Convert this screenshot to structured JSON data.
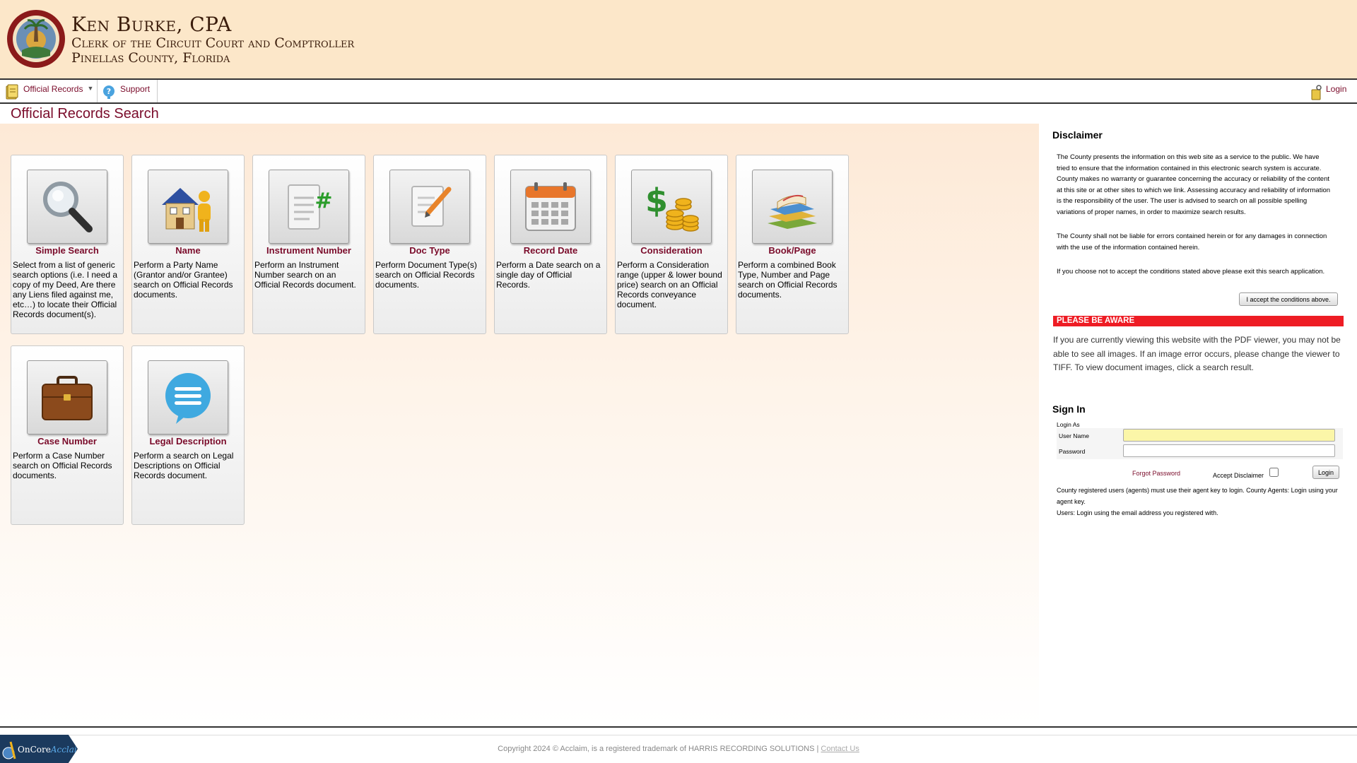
{
  "header": {
    "name": "Ken Burke, CPA",
    "subtitle1": "Clerk of the Circuit Court and Comptroller",
    "subtitle2": "Pinellas County, Florida"
  },
  "nav": {
    "official_records": "Official Records",
    "support": "Support",
    "login": "Login"
  },
  "page_title": "Official Records Search",
  "tiles_row1": [
    {
      "name": "Simple Search",
      "desc": "Select from a list of generic search options (i.e. I need a copy of my Deed, Are there any Liens filed against me, etc…) to locate their Official Records document(s)."
    },
    {
      "name": "Name",
      "desc": "Perform a Party Name (Grantor and/or Grantee) search on Official Records documents."
    },
    {
      "name": "Instrument Number",
      "desc": "Perform an Instrument Number search on an Official Records document."
    },
    {
      "name": "Doc Type",
      "desc": "Perform Document Type(s) search on Official Records documents."
    },
    {
      "name": "Record Date",
      "desc": "Perform a Date search on a single day of Official Records."
    },
    {
      "name": "Consideration",
      "desc": "Perform a Consideration range (upper & lower bound price) search on an Official Records conveyance document."
    },
    {
      "name": "Book/Page",
      "desc": "Perform a combined Book Type, Number and Page search on Official Records documents."
    }
  ],
  "tiles_row2": [
    {
      "name": "Case Number",
      "desc": "Perform a Case Number search on Official Records documents."
    },
    {
      "name": "Legal Description",
      "desc": "Perform a search on Legal Descriptions on Official Records document."
    }
  ],
  "disclaimer": {
    "title": "Disclaimer",
    "p1": "The County presents the information on this web site as a service to the public. We have tried to ensure that the information contained in this electronic search system is accurate. County makes no warranty or guarantee concerning the accuracy or reliability of the content at this site or at other sites to which we link. Assessing accuracy and reliability of information is the responsibility of the user. The user is advised to search on all possible spelling variations of proper names, in order to maximize search results.",
    "p2": "The County shall not be liable for errors contained herein or for any damages in connection with the use of the information contained herein.",
    "p3": "If you choose not to accept the conditions stated above please exit this search application.",
    "accept_button": "I accept the conditions above."
  },
  "aware": {
    "title": "PLEASE BE AWARE",
    "text": "If you are currently viewing this website with the PDF viewer, you may not be able to see all images. If an image error occurs, please change the viewer to TIFF. To view document images, click a search result."
  },
  "signin": {
    "title": "Sign In",
    "login_as": "Login As",
    "username_label": "User Name",
    "password_label": "Password",
    "username_value": "",
    "password_value": "",
    "forgot": "Forgot Password",
    "accept_disclaimer": "Accept Disclaimer",
    "login_button": "Login",
    "note1": "County registered users (agents) must use their agent key to login. County Agents: Login using your agent key.",
    "note2": "Users: Login using the email address you registered with."
  },
  "footer": {
    "logo_part1": "OnCore",
    "logo_part2": "Acclaim",
    "copyright": "Copyright 2024 © Acclaim, is a registered trademark of HARRIS RECORDING SOLUTIONS |",
    "contact": "Contact Us"
  },
  "colors": {
    "header_bg": "#fce7c9",
    "accent": "#7a0b2a",
    "aware_red": "#ee1c24"
  },
  "icons": {
    "simple_search": "magnifier-icon",
    "name": "house-person-icon",
    "instrument_number": "document-hash-icon",
    "doc_type": "document-pencil-icon",
    "record_date": "calendar-icon",
    "consideration": "money-icon",
    "book_page": "books-icon",
    "case_number": "briefcase-icon",
    "legal_description": "speech-bubble-icon"
  }
}
